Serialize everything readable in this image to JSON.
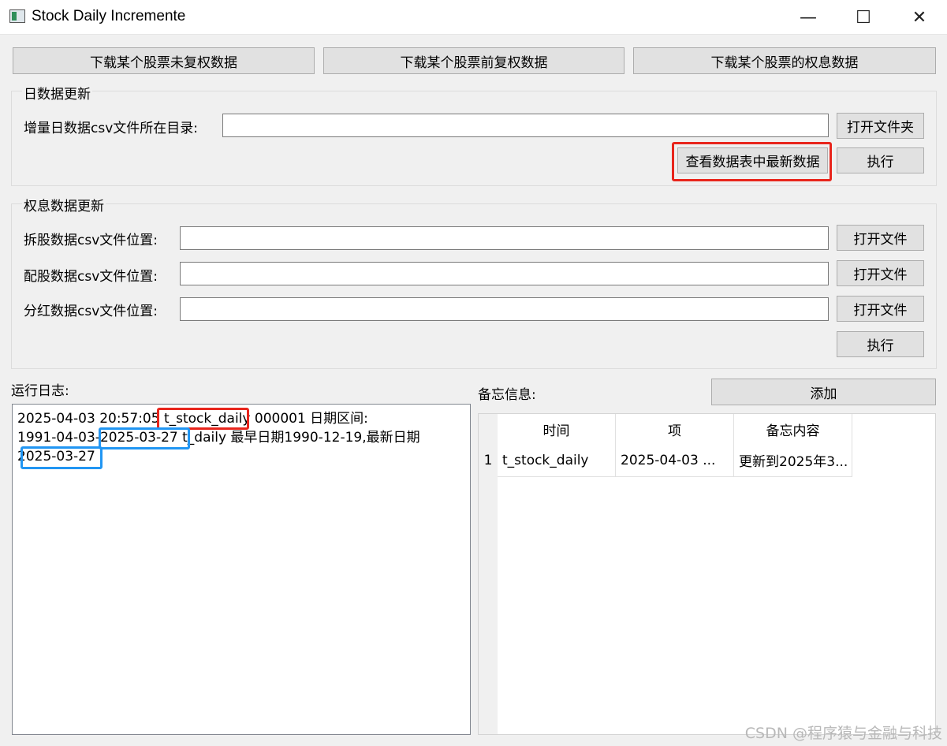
{
  "window": {
    "title": "Stock Daily Incremente",
    "minimize": "—",
    "maximize": "☐",
    "close": "✕"
  },
  "top_buttons": [
    "下载某个股票未复权数据",
    "下载某个股票前复权数据",
    "下载某个股票的权息数据"
  ],
  "daily_group": {
    "title": "日数据更新",
    "dir_label": "增量日数据csv文件所在目录:",
    "dir_value": "",
    "open_folder": "打开文件夹",
    "view_latest": "查看数据表中最新数据",
    "execute": "执行"
  },
  "rights_group": {
    "title": "权息数据更新",
    "split_label": "拆股数据csv文件位置:",
    "allot_label": "配股数据csv文件位置:",
    "dividend_label": "分红数据csv文件位置:",
    "open_file": "打开文件",
    "execute": "执行"
  },
  "log": {
    "label": "运行日志:",
    "line1_prefix": "2025-04-03 20:57:05 ",
    "line1_table": "t_stock_daily",
    "line1_suffix": " 000001 日期区间:",
    "line2_start": "1991-04-03-",
    "line2_end": "2025-03-27",
    "line2_suffix": " t_daily 最早日期1990-12-19,最新日期",
    "line3": "2025-03-27"
  },
  "memo": {
    "label": "备忘信息:",
    "add": "添加",
    "headers": [
      "时间",
      "项",
      "备忘内容"
    ],
    "rows": [
      {
        "num": "1",
        "time": "t_stock_daily",
        "item": "2025-04-03 ...",
        "content": "更新到2025年3..."
      }
    ]
  },
  "watermark": "CSDN @程序猿与金融与科技"
}
